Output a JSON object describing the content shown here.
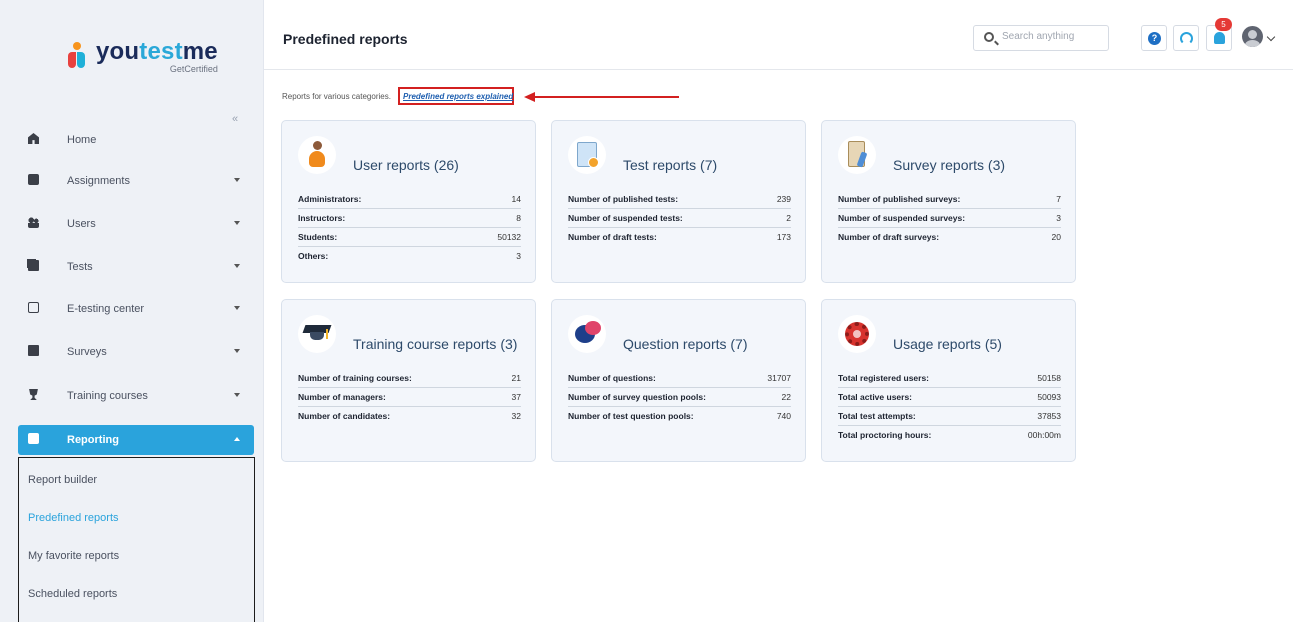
{
  "brand": {
    "name_part1": "you",
    "name_part2": "test",
    "name_part3": "me",
    "tagline": "GetCertified"
  },
  "sidebar": {
    "collapse_glyph": "«",
    "items": [
      {
        "label": "Home",
        "icon": "home-icon"
      },
      {
        "label": "Assignments",
        "icon": "assignments-icon"
      },
      {
        "label": "Users",
        "icon": "users-icon"
      },
      {
        "label": "Tests",
        "icon": "tests-icon"
      },
      {
        "label": "E-testing center",
        "icon": "e-testing-center-icon"
      },
      {
        "label": "Surveys",
        "icon": "surveys-icon"
      },
      {
        "label": "Training courses",
        "icon": "trophy-icon"
      },
      {
        "label": "Reporting",
        "icon": "reporting-icon"
      }
    ],
    "reporting_submenu": [
      {
        "label": "Report builder"
      },
      {
        "label": "Predefined reports"
      },
      {
        "label": "My favorite reports"
      },
      {
        "label": "Scheduled reports"
      }
    ]
  },
  "header": {
    "title": "Predefined reports",
    "search_placeholder": "Search anything",
    "help_glyph": "?",
    "notification_count": "5"
  },
  "intro": {
    "text": "Reports for various categories.",
    "link_label": "Predefined reports explained"
  },
  "cards": [
    {
      "title": "User reports (26)",
      "icon": "user-reports-icon",
      "rows": [
        {
          "label": "Administrators:",
          "value": "14"
        },
        {
          "label": "Instructors:",
          "value": "8"
        },
        {
          "label": "Students:",
          "value": "50132"
        },
        {
          "label": "Others:",
          "value": "3"
        }
      ]
    },
    {
      "title": "Test reports (7)",
      "icon": "test-reports-icon",
      "rows": [
        {
          "label": "Number of published tests:",
          "value": "239"
        },
        {
          "label": "Number of suspended tests:",
          "value": "2"
        },
        {
          "label": "Number of draft tests:",
          "value": "173"
        }
      ]
    },
    {
      "title": "Survey reports (3)",
      "icon": "survey-reports-icon",
      "rows": [
        {
          "label": "Number of published surveys:",
          "value": "7"
        },
        {
          "label": "Number of suspended surveys:",
          "value": "3"
        },
        {
          "label": "Number of draft surveys:",
          "value": "20"
        }
      ]
    },
    {
      "title": "Training course reports (3)",
      "icon": "graduation-cap-icon",
      "rows": [
        {
          "label": "Number of training courses:",
          "value": "21"
        },
        {
          "label": "Number of managers:",
          "value": "37"
        },
        {
          "label": "Number of candidates:",
          "value": "32"
        }
      ]
    },
    {
      "title": "Question reports (7)",
      "icon": "speech-bubbles-icon",
      "rows": [
        {
          "label": "Number of questions:",
          "value": "31707"
        },
        {
          "label": "Number of survey question pools:",
          "value": "22"
        },
        {
          "label": "Number of test question pools:",
          "value": "740"
        }
      ]
    },
    {
      "title": "Usage reports (5)",
      "icon": "gear-icon",
      "rows": [
        {
          "label": "Total registered users:",
          "value": "50158"
        },
        {
          "label": "Total active users:",
          "value": "50093"
        },
        {
          "label": "Total test attempts:",
          "value": "37853"
        },
        {
          "label": "Total proctoring hours:",
          "value": "00h:00m"
        }
      ]
    }
  ],
  "colors": {
    "accent": "#2aa3dc",
    "annotation_red": "#d32020",
    "sidebar_bg": "#eef1f6",
    "card_bg": "#f3f6fb"
  }
}
